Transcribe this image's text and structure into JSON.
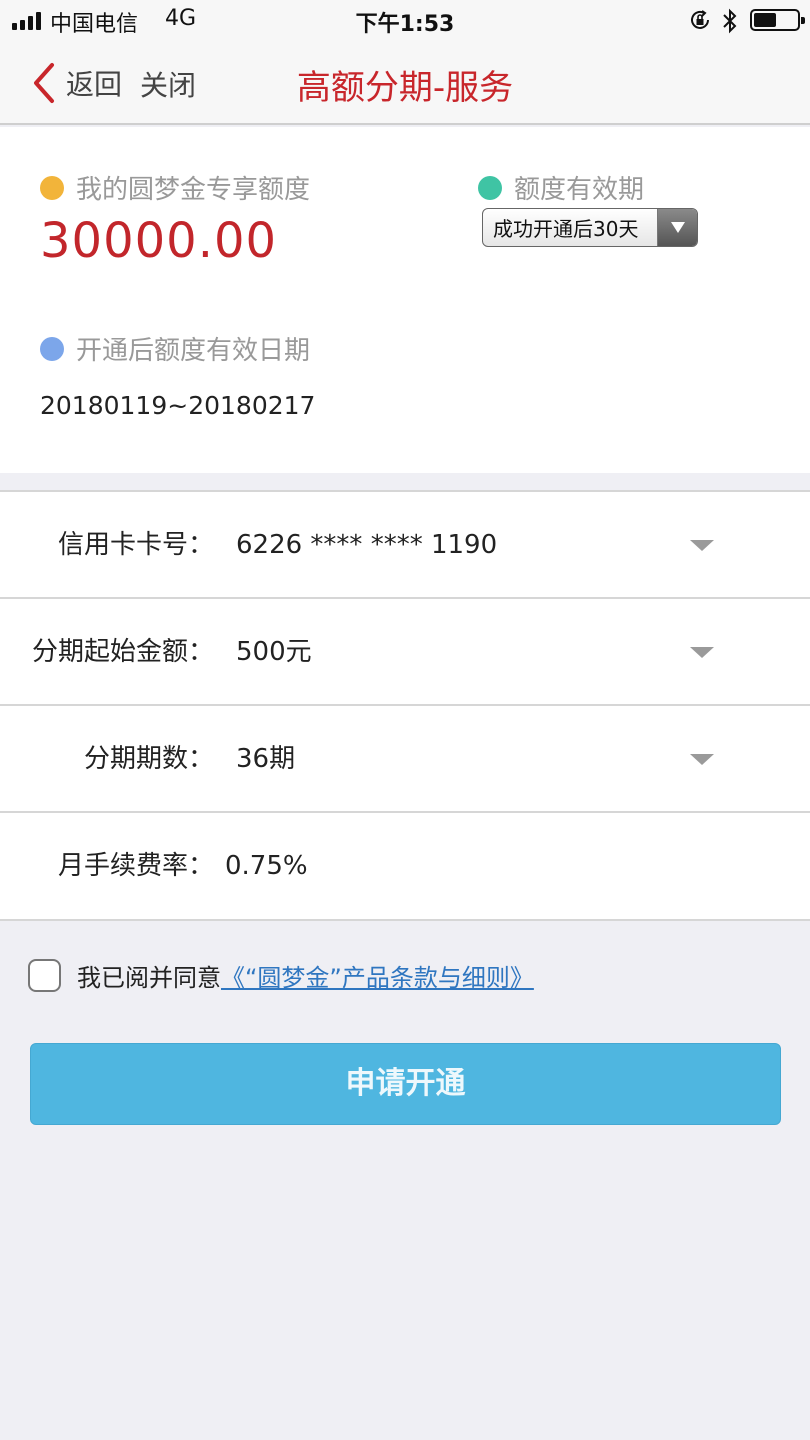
{
  "status_bar": {
    "carrier": "中国电信",
    "network": "4G",
    "time": "下午1:53"
  },
  "nav": {
    "back_label": "返回",
    "close_label": "关闭",
    "title": "高额分期-服务"
  },
  "quota": {
    "amount_label": "我的圆梦金专享额度",
    "amount_value": "30000.00",
    "validity_label": "额度有效期",
    "validity_selected": "成功开通后30天",
    "date_label": "开通后额度有效日期",
    "date_range": "20180119~20180217"
  },
  "form": {
    "rows": [
      {
        "label": "信用卡卡号：",
        "value": "6226 **** **** 1190"
      },
      {
        "label": "分期起始金额：",
        "value": "500元"
      },
      {
        "label": "分期期数：",
        "value": "36期"
      },
      {
        "label": "月手续费率：",
        "value": "0.75%"
      }
    ]
  },
  "agreement": {
    "text": "我已阅并同意",
    "link": "《“圆梦金”产品条款与细则》"
  },
  "submit": {
    "label": "申请开通"
  },
  "colors": {
    "accent_red": "#c8262b",
    "dot_yellow": "#f2b43a",
    "dot_teal": "#3fc4a4",
    "dot_blue": "#7ca6ea",
    "button_blue": "#4fb6e0",
    "link_blue": "#2f76c0"
  }
}
